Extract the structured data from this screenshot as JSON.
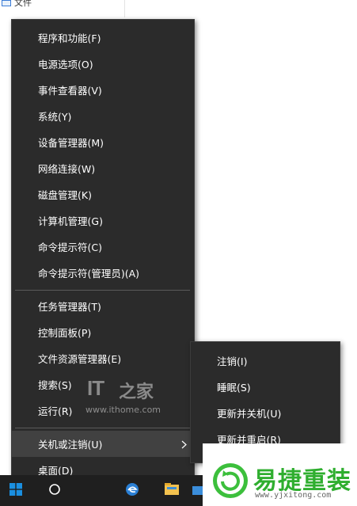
{
  "background": {
    "file_label": "文件"
  },
  "context_menu": {
    "items": [
      {
        "label": "程序和功能(F)"
      },
      {
        "label": "电源选项(O)"
      },
      {
        "label": "事件查看器(V)"
      },
      {
        "label": "系统(Y)"
      },
      {
        "label": "设备管理器(M)"
      },
      {
        "label": "网络连接(W)"
      },
      {
        "label": "磁盘管理(K)"
      },
      {
        "label": "计算机管理(G)"
      },
      {
        "label": "命令提示符(C)"
      },
      {
        "label": "命令提示符(管理员)(A)"
      },
      {
        "label": "任务管理器(T)"
      },
      {
        "label": "控制面板(P)"
      },
      {
        "label": "文件资源管理器(E)"
      },
      {
        "label": "搜索(S)"
      },
      {
        "label": "运行(R)"
      },
      {
        "label": "关机或注销(U)"
      },
      {
        "label": "桌面(D)"
      }
    ]
  },
  "submenu": {
    "items": [
      {
        "label": "注销(I)"
      },
      {
        "label": "睡眠(S)"
      },
      {
        "label": "更新并关机(U)"
      },
      {
        "label": "更新并重启(R)"
      }
    ]
  },
  "watermark": {
    "brand": "IT",
    "brand_cn": "之家",
    "url": "www.ithome.com"
  },
  "logo": {
    "name": "易捷重装",
    "url": "www.yjxitong.com",
    "color": "#2fae2f"
  },
  "icons": {
    "start": "windows-logo-icon",
    "search": "search-icon",
    "edge": "edge-icon",
    "explorer": "folder-icon",
    "store": "store-icon",
    "submenu_arrow": "chevron-right-icon",
    "logo": "refresh-logo-icon"
  },
  "colors": {
    "menu_bg": "#2b2b2b",
    "menu_active": "#414141",
    "taskbar": "#1f1f1f",
    "separator": "#5a5a5a"
  }
}
